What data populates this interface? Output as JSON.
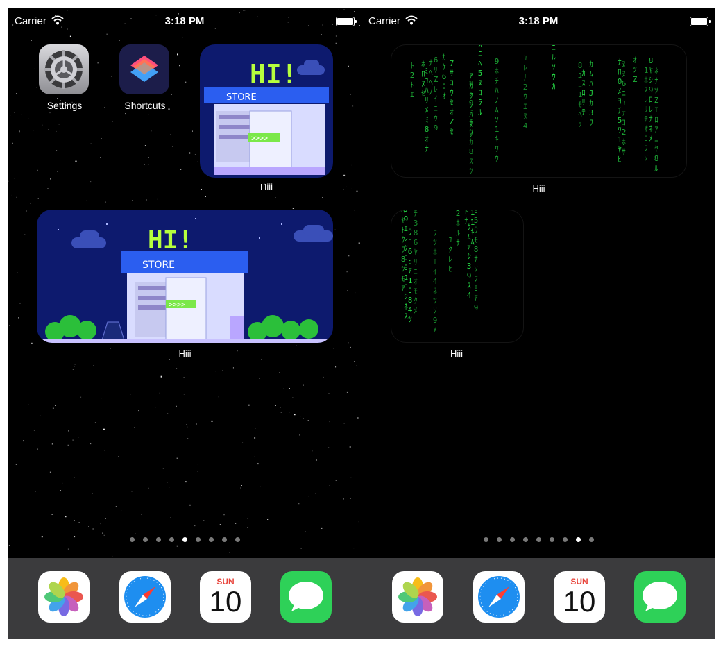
{
  "status": {
    "carrier": "Carrier",
    "time": "3:18 PM"
  },
  "left_page": {
    "apps": [
      {
        "label": "Settings",
        "icon": "settings-gear-icon"
      },
      {
        "label": "Shortcuts",
        "icon": "shortcuts-icon"
      }
    ],
    "small_widget": {
      "label": "Hiii",
      "sign_text": "HI!",
      "store_text": "STORE",
      "arrows": ">>>>"
    },
    "medium_widget": {
      "label": "Hiii",
      "sign_text": "HI!",
      "store_text": "STORE",
      "arrows": ">>>>"
    },
    "page_dots": {
      "count": 9,
      "active_index": 4
    }
  },
  "right_page": {
    "medium_widget": {
      "label": "Hiii",
      "style": "matrix-rain"
    },
    "small_widget": {
      "label": "Hiii",
      "style": "matrix-rain"
    },
    "page_dots": {
      "count": 9,
      "active_index": 7
    }
  },
  "dock": {
    "apps": [
      {
        "name": "Photos",
        "icon": "photos-icon"
      },
      {
        "name": "Safari",
        "icon": "safari-compass-icon"
      },
      {
        "name": "Calendar",
        "icon": "calendar-icon",
        "day": "SUN",
        "date": "10"
      },
      {
        "name": "Messages",
        "icon": "messages-bubble-icon"
      }
    ]
  },
  "colors": {
    "matrix_green": "#28e84a",
    "store_sign_green": "#b6ff3d",
    "dock_bg": "#3b3b3d",
    "calendar_red": "#e8453c"
  }
}
